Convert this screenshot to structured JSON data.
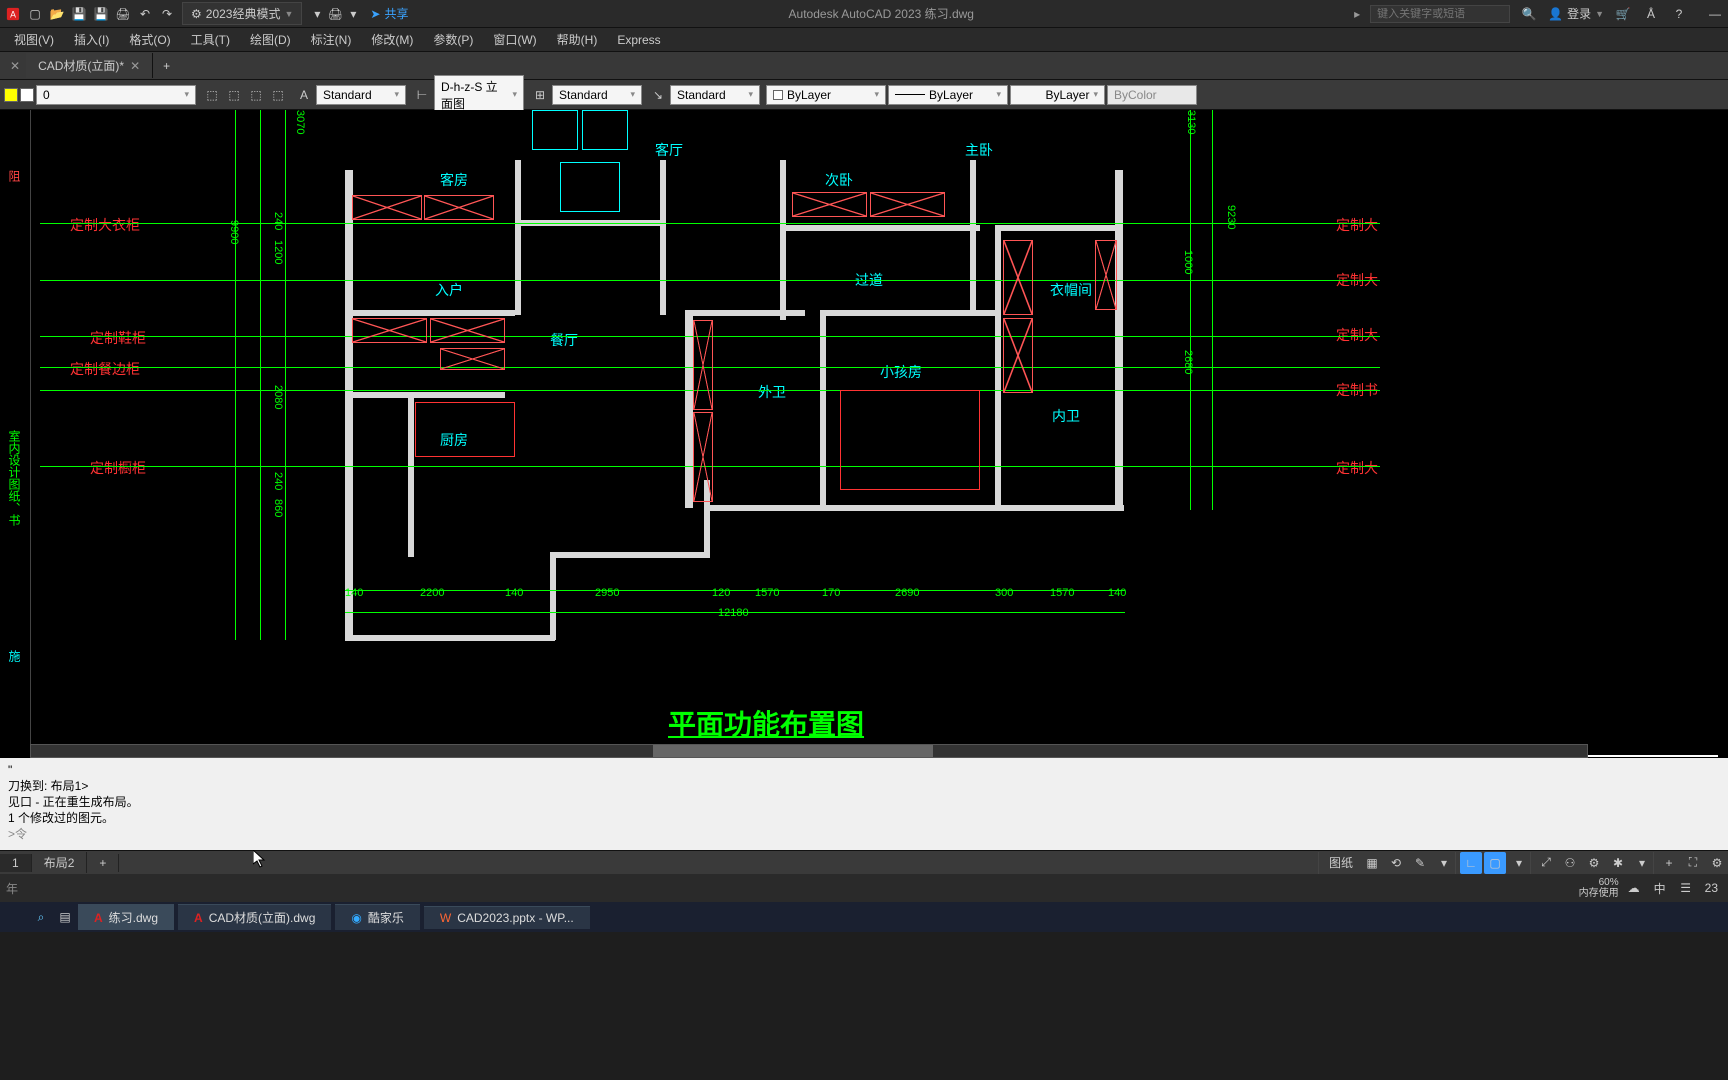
{
  "app_title": "Autodesk AutoCAD 2023  练习.dwg",
  "workspace": "2023经典模式",
  "share_label": "共享",
  "search_placeholder": "键入关键字或短语",
  "login_label": "登录",
  "menus": [
    "视图(V)",
    "插入(I)",
    "格式(O)",
    "工具(T)",
    "绘图(D)",
    "标注(N)",
    "修改(M)",
    "参数(P)",
    "窗口(W)",
    "帮助(H)",
    "Express"
  ],
  "doc_tabs": [
    {
      "label": "CAD材质(立面)*",
      "active": true
    }
  ],
  "toolbar": {
    "layer_value": "0",
    "textstyle": "Standard",
    "dimstyle": "D-h-z-S 立面图",
    "tablestyle": "Standard",
    "mleader": "Standard",
    "linetype": "ByLayer",
    "lineweight": "ByLayer",
    "linecolor": "ByLayer",
    "plotstyle": "ByColor"
  },
  "rooms": {
    "guest_room": "客房",
    "living_room": "客厅",
    "secondary_bed": "次卧",
    "master_bed": "主卧",
    "entry": "入户",
    "corridor": "过道",
    "wardrobe_room": "衣帽间",
    "dining": "餐厅",
    "kitchen": "厨房",
    "outer_bath": "外卫",
    "kids_room": "小孩房",
    "inner_bath": "内卫"
  },
  "labels": {
    "custom_wardrobe": "定制大衣柜",
    "custom_shoe_cabinet": "定制鞋柜",
    "custom_sideboard": "定制餐边柜",
    "custom_kitchen_cabinet": "定制橱柜",
    "custom_big_r1": "定制大",
    "custom_book_r": "定制书"
  },
  "dims": {
    "d3070": "3070",
    "d3130": "3130",
    "d9900": "9900",
    "d240a": "240",
    "d1200": "1200",
    "d2080": "2080",
    "d240b": "240",
    "d860": "860",
    "d9230": "9230",
    "d1000": "1000",
    "d2680": "2680",
    "d140a": "140",
    "d2200": "2200",
    "d140b": "140",
    "d2950": "2950",
    "d120": "120",
    "d1570a": "1570",
    "d170": "170",
    "d2690": "2690",
    "d300": "300",
    "d1570b": "1570",
    "d140c": "140",
    "d12180": "12180"
  },
  "figure_title": "平面功能布置图",
  "cmdlog": [
    "\"",
    "刀换到: 布局1>",
    "见口 - 正在重生成布局。",
    "1 个修改过的图元。",
    ">令"
  ],
  "layout_tabs": [
    "1",
    "布局2",
    "+"
  ],
  "status": {
    "paper_label": "图纸",
    "zoom": "60%",
    "mem": "内存使用",
    "lang": "中",
    "time": "23"
  },
  "taskbar": {
    "items": [
      {
        "label": "练习.dwg",
        "icon": "A"
      },
      {
        "label": "CAD材质(立面).dwg",
        "icon": "A"
      },
      {
        "label": "酷家乐",
        "icon": "K"
      },
      {
        "label": "CAD2023.pptx - WP...",
        "icon": "W"
      }
    ]
  }
}
